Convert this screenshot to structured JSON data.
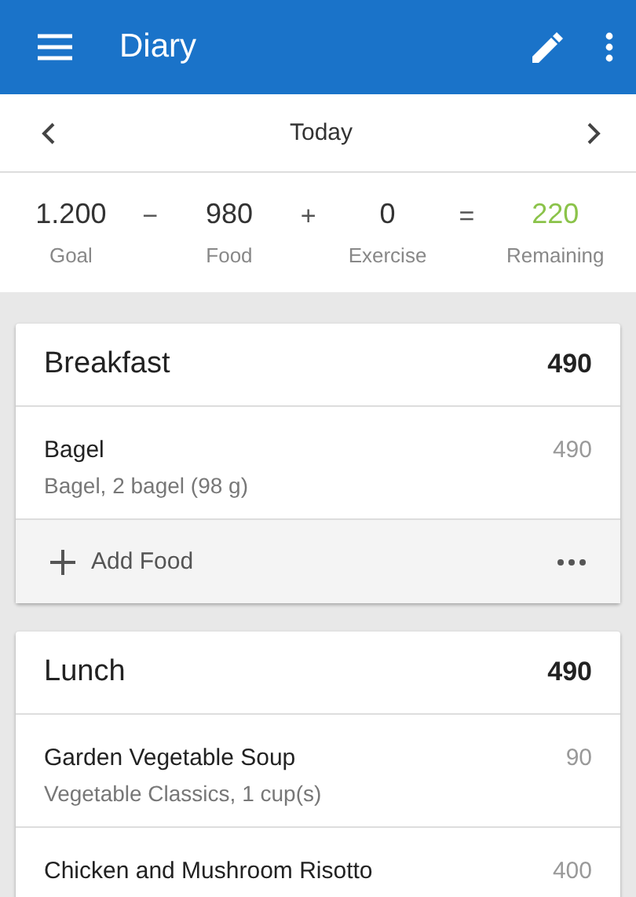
{
  "app_bar": {
    "title": "Diary"
  },
  "date_nav": {
    "label": "Today"
  },
  "summary": [
    {
      "kind": "term",
      "value": "1.200",
      "label": "Goal"
    },
    {
      "kind": "operator",
      "value": "−"
    },
    {
      "kind": "term",
      "value": "980",
      "label": "Food"
    },
    {
      "kind": "operator",
      "value": "+"
    },
    {
      "kind": "term",
      "value": "0",
      "label": "Exercise"
    },
    {
      "kind": "operator",
      "value": "="
    },
    {
      "kind": "result",
      "value": "220",
      "label": "Remaining"
    }
  ],
  "meals": [
    {
      "name": "Breakfast",
      "calories": "490",
      "items": [
        {
          "name": "Bagel",
          "detail": "Bagel, 2 bagel (98 g)",
          "calories": "490"
        }
      ],
      "add_food": "Add Food"
    },
    {
      "name": "Lunch",
      "calories": "490",
      "items": [
        {
          "name": "Garden Vegetable Soup",
          "detail": "Vegetable Classics, 1 cup(s)",
          "calories": "90"
        },
        {
          "name": "Chicken and Mushroom Risotto",
          "calories": "400"
        }
      ]
    }
  ]
}
